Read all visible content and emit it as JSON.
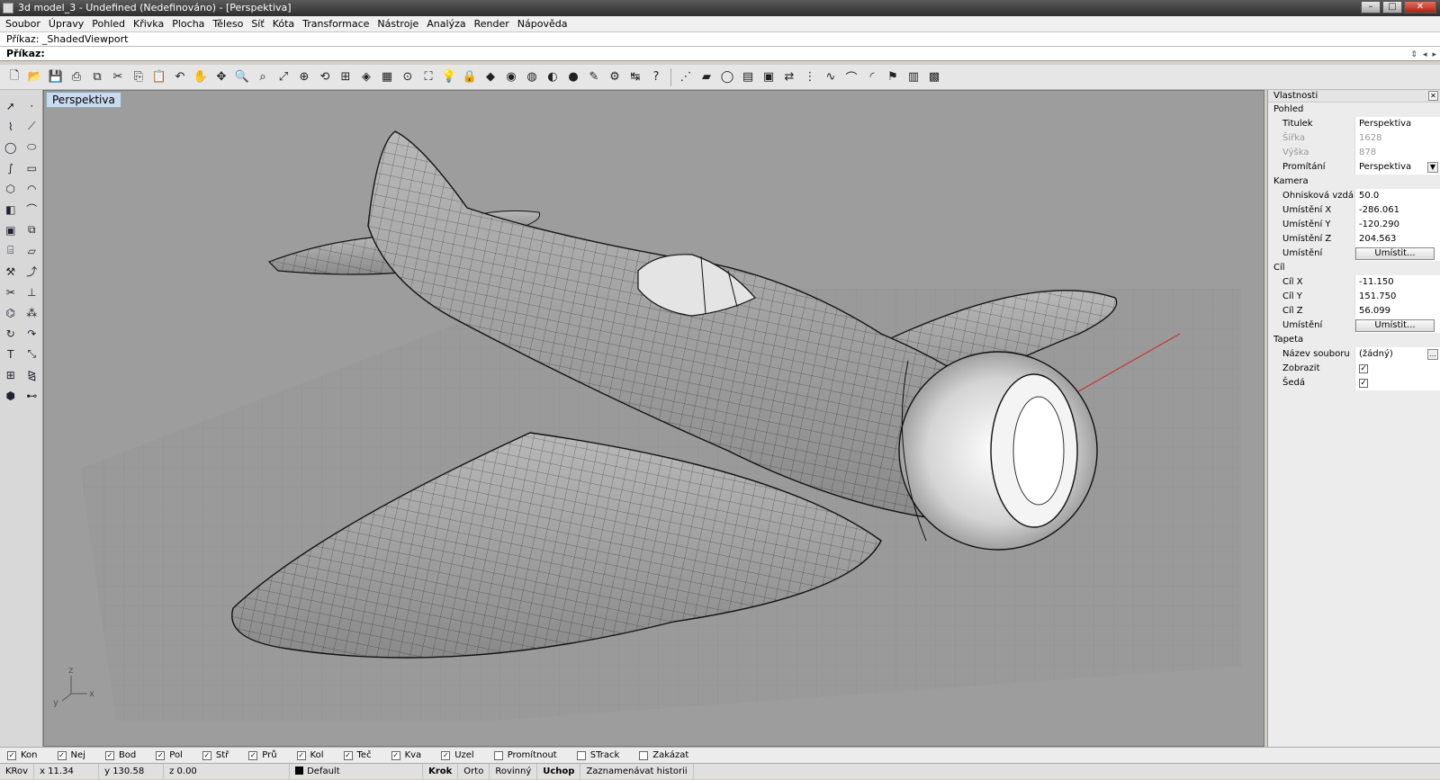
{
  "window": {
    "title": "3d model_3 - Undefined (Nedefinováno) - [Perspektiva]"
  },
  "menu": [
    "Soubor",
    "Úpravy",
    "Pohled",
    "Křivka",
    "Plocha",
    "Těleso",
    "Síť",
    "Kóta",
    "Transformace",
    "Nástroje",
    "Analýza",
    "Render",
    "Nápověda"
  ],
  "command": {
    "history": "Příkaz: _ShadedViewport",
    "label": "Příkaz:",
    "value": ""
  },
  "viewport": {
    "title": "Perspektiva",
    "axis_x": "x",
    "axis_y": "y",
    "axis_z": "z"
  },
  "properties": {
    "panel_title": "Vlastnosti",
    "view_section": "Pohled",
    "view_rows": [
      {
        "key": "Titulek",
        "value": "Perspektiva"
      },
      {
        "key": "Šířka",
        "value": "1628"
      },
      {
        "key": "Výška",
        "value": "878"
      },
      {
        "key": "Promítání",
        "value": "Perspektiva"
      }
    ],
    "camera_section": "Kamera",
    "camera_rows": [
      {
        "key": "Ohnisková vzdále...",
        "value": "50.0"
      },
      {
        "key": "Umístění X",
        "value": "-286.061"
      },
      {
        "key": "Umístění Y",
        "value": "-120.290"
      },
      {
        "key": "Umístění Z",
        "value": "204.563"
      },
      {
        "key": "Umístění",
        "value": "Umístit..."
      }
    ],
    "target_section": "Cíl",
    "target_rows": [
      {
        "key": "Cíl X",
        "value": "-11.150"
      },
      {
        "key": "Cíl Y",
        "value": "151.750"
      },
      {
        "key": "Cíl Z",
        "value": "56.099"
      },
      {
        "key": "Umístění",
        "value": "Umístit..."
      }
    ],
    "wallpaper_section": "Tapeta",
    "wallpaper_rows": [
      {
        "key": "Název souboru",
        "value": "(žádný)"
      },
      {
        "key": "Zobrazit",
        "value": "✓"
      },
      {
        "key": "Šedá",
        "value": "✓"
      }
    ]
  },
  "osnaps": [
    {
      "label": "Kon",
      "checked": "✓"
    },
    {
      "label": "Nej",
      "checked": "✓"
    },
    {
      "label": "Bod",
      "checked": "✓"
    },
    {
      "label": "Pol",
      "checked": "✓"
    },
    {
      "label": "Stř",
      "checked": "✓"
    },
    {
      "label": "Prů",
      "checked": "✓"
    },
    {
      "label": "Kol",
      "checked": "✓"
    },
    {
      "label": "Teč",
      "checked": "✓"
    },
    {
      "label": "Kva",
      "checked": "✓"
    },
    {
      "label": "Uzel",
      "checked": "✓"
    },
    {
      "label": "Promítnout",
      "checked": ""
    },
    {
      "label": "STrack",
      "checked": ""
    },
    {
      "label": "Zakázat",
      "checked": ""
    }
  ],
  "status": {
    "cplane": "KRov",
    "x": "x 11.34",
    "y": "y 130.58",
    "z": "z 0.00",
    "layer": "Default",
    "toggles": [
      "Krok",
      "Orto",
      "Rovinný",
      "Uchop",
      "Zaznamenávat historii"
    ]
  },
  "colors": {
    "viewport_bg": "#9d9d9d",
    "viewport_label_bg": "#c9daf1",
    "titlebar": "#3a3a3a"
  }
}
